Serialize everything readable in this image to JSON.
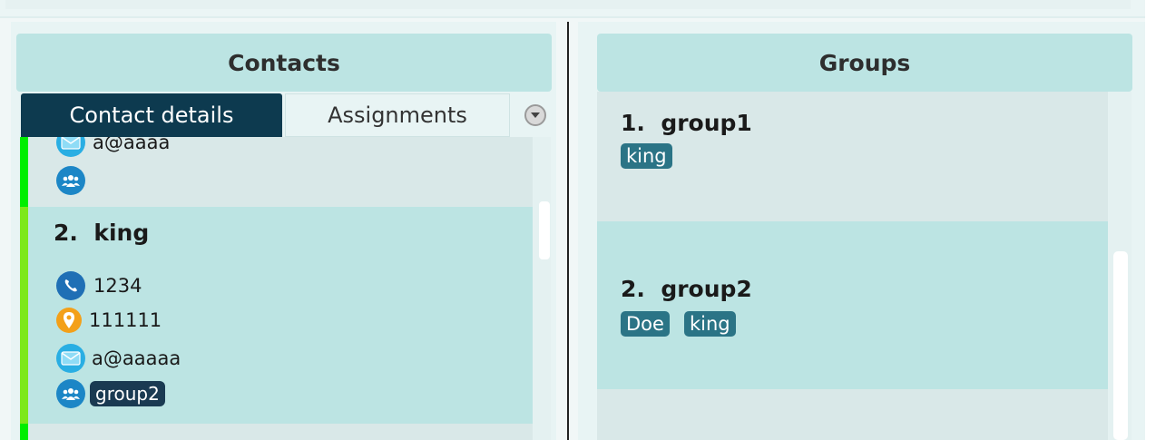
{
  "contacts": {
    "header": "Contacts",
    "tabs": [
      {
        "label": "Contact details",
        "active": true
      },
      {
        "label": "Assignments",
        "active": false
      }
    ],
    "list": [
      {
        "partial": true,
        "email": "a@aaaa",
        "bar_color": "#00ee00",
        "groups": []
      },
      {
        "index": "2.",
        "name": "king",
        "phone": "1234",
        "address": "111111",
        "email": "a@aaaaa",
        "groups": [
          "group2"
        ],
        "bar_color": "#7de81b"
      },
      {
        "partial": true,
        "bar_color": "#00ee00"
      }
    ]
  },
  "groups": {
    "header": "Groups",
    "list": [
      {
        "index": "1.",
        "name": "group1",
        "members": [
          "king"
        ]
      },
      {
        "index": "2.",
        "name": "group2",
        "members": [
          "Doe",
          "king"
        ]
      }
    ]
  },
  "colors": {
    "header_bg": "#bce4e3",
    "active_tab_bg": "#0d3a4f",
    "selected_card_bg": "#bce4e3",
    "card_bg": "#d9e8e8",
    "group_tag_bg": "#2b7486",
    "contact_group_tag_bg": "#1a3a52"
  },
  "icons": {
    "phone": "phone-icon",
    "address": "location-pin-icon",
    "email": "envelope-icon",
    "groups": "people-group-icon",
    "dropdown": "chevron-down-icon"
  }
}
